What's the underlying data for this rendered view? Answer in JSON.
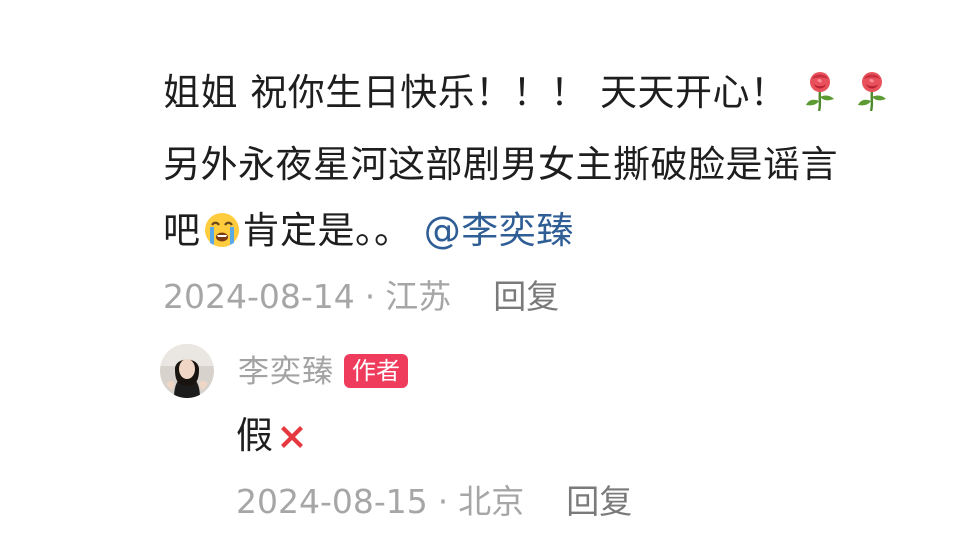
{
  "comment": {
    "line1_text": "姐姐 祝你生日快乐！！！ 天天开心！",
    "line1_emojis": [
      "rose-emoji",
      "rose-emoji"
    ],
    "line2_text": "另外永夜星河这部剧男女主撕破脸是谣言",
    "line3_prefix": "吧",
    "line3_emoji": "loudly-crying-face-emoji",
    "line3_suffix": "肯定是。。",
    "mention": "@李奕臻",
    "date": "2024-08-14",
    "separator": "·",
    "location": "江苏",
    "reply_label": "回复"
  },
  "reply": {
    "avatar": "user-avatar",
    "author": "李奕臻",
    "badge": "作者",
    "text": "假",
    "text_emoji": "cross-mark-emoji",
    "date": "2024-08-15",
    "separator": "·",
    "location": "北京",
    "reply_label": "回复"
  },
  "colors": {
    "mention": "#2f5d95",
    "badge_bg": "#ef3b5c",
    "meta": "#a6a6a6",
    "author": "#a3a3a3"
  }
}
